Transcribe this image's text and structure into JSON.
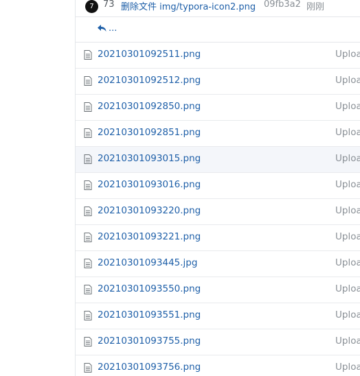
{
  "latest_commit": {
    "avatar_text": "7",
    "count": "73",
    "message": "删除文件 img/typora-icon2.png",
    "hash": "09fb3a2",
    "time": "刚刚"
  },
  "parent": {
    "label": "..."
  },
  "files": [
    {
      "name": "20210301092511.png",
      "commit": "Upload"
    },
    {
      "name": "20210301092512.png",
      "commit": "Upload"
    },
    {
      "name": "20210301092850.png",
      "commit": "Upload"
    },
    {
      "name": "20210301092851.png",
      "commit": "Upload"
    },
    {
      "name": "20210301093015.png",
      "commit": "Upload"
    },
    {
      "name": "20210301093016.png",
      "commit": "Upload"
    },
    {
      "name": "20210301093220.png",
      "commit": "Upload"
    },
    {
      "name": "20210301093221.png",
      "commit": "Upload"
    },
    {
      "name": "20210301093445.jpg",
      "commit": "Upload"
    },
    {
      "name": "20210301093550.png",
      "commit": "Upload"
    },
    {
      "name": "20210301093551.png",
      "commit": "Upload"
    },
    {
      "name": "20210301093755.png",
      "commit": "Upload"
    },
    {
      "name": "20210301093756.png",
      "commit": "Upload"
    }
  ],
  "colors": {
    "link": "#1e5fa8",
    "muted": "#8a9096",
    "hover_row": "#f4f6fa",
    "border": "#e8eaed"
  }
}
